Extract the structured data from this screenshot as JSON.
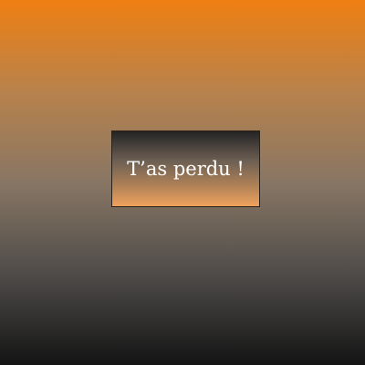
{
  "game": {
    "status_message": "T’as perdu !"
  },
  "colors": {
    "background_top": "#ef7f12",
    "background_bottom": "#141414",
    "box_top": "#242424",
    "box_bottom": "#f0a25c",
    "text": "#ffffff"
  }
}
